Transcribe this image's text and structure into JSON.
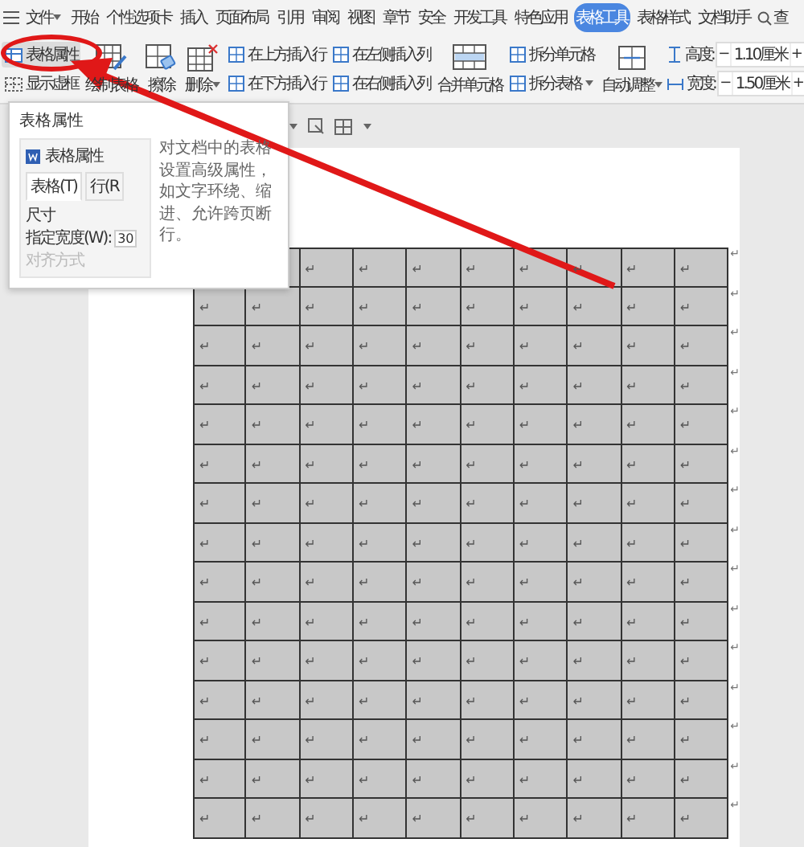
{
  "menubar": {
    "items": [
      {
        "label": "文件",
        "selected": false
      },
      {
        "label": "开始",
        "selected": false
      },
      {
        "label": "个性选项卡",
        "selected": false
      },
      {
        "label": "插入",
        "selected": false
      },
      {
        "label": "页面布局",
        "selected": false
      },
      {
        "label": "引用",
        "selected": false
      },
      {
        "label": "审阅",
        "selected": false
      },
      {
        "label": "视图",
        "selected": false
      },
      {
        "label": "章节",
        "selected": false
      },
      {
        "label": "安全",
        "selected": false
      },
      {
        "label": "开发工具",
        "selected": false
      },
      {
        "label": "特色应用",
        "selected": false
      },
      {
        "label": "表格工具",
        "selected": true
      },
      {
        "label": "表格样式",
        "selected": false
      },
      {
        "label": "文档助手",
        "selected": false
      }
    ],
    "search": "查"
  },
  "ribbon": {
    "groups": [
      {
        "kind": "stack",
        "items": [
          {
            "label": "表格属性",
            "hovered": true,
            "dropdown": false
          },
          {
            "label": "显示虚框",
            "hovered": false,
            "dropdown": false
          }
        ]
      },
      {
        "kind": "large",
        "label": "绘制表格",
        "hovered": false,
        "dropdown": false
      },
      {
        "kind": "large",
        "label": "擦除",
        "hovered": false,
        "dropdown": false
      },
      {
        "kind": "large",
        "label": "删除",
        "hovered": false,
        "dropdown": true
      },
      {
        "kind": "stack",
        "items": [
          {
            "label": "在上方插入行",
            "hovered": false,
            "dropdown": false
          },
          {
            "label": "在下方插入行",
            "hovered": false,
            "dropdown": false
          }
        ]
      },
      {
        "kind": "stack",
        "items": [
          {
            "label": "在左侧插入列",
            "hovered": false,
            "dropdown": false
          },
          {
            "label": "在右侧插入列",
            "hovered": false,
            "dropdown": false
          }
        ]
      },
      {
        "kind": "large",
        "label": "合并单元格",
        "hovered": false,
        "dropdown": false
      },
      {
        "kind": "stack",
        "items": [
          {
            "label": "拆分单元格",
            "hovered": false,
            "dropdown": false
          },
          {
            "label": "拆分表格",
            "hovered": false,
            "dropdown": true
          }
        ]
      },
      {
        "kind": "large",
        "label": "自动调整",
        "hovered": false,
        "dropdown": true
      },
      {
        "kind": "size",
        "rows": [
          {
            "label": "高度:",
            "value": "1.10厘米",
            "minus": "−",
            "plus": "+"
          },
          {
            "label": "宽度:",
            "value": "1.50厘米",
            "minus": "−",
            "plus": "+"
          }
        ]
      }
    ]
  },
  "tooltip": {
    "title": "表格属性",
    "preview": {
      "title": "表格属性",
      "tabs": [
        {
          "label": "表格(T)",
          "selected": true
        },
        {
          "label": "行(R",
          "selected": false
        }
      ],
      "section": "尺寸",
      "width_label": "指定宽度(W):",
      "width_value": "30",
      "section_2": "对齐方式"
    },
    "description": "对文档中的表格设置高级属性，如文字环绕、缩进、允许跨页断行。"
  },
  "table": {
    "rows": [
      {
        "cells": [
          null,
          null,
          "↵",
          "↵",
          "↵",
          "↵",
          "↵",
          "↵",
          "↵",
          "↵"
        ],
        "end": "↵"
      },
      {
        "cells": [
          "↵",
          "↵",
          "↵",
          "↵",
          "↵",
          "↵",
          "↵",
          "↵",
          "↵",
          "↵"
        ],
        "end": "↵"
      },
      {
        "cells": [
          "↵",
          "↵",
          "↵",
          "↵",
          "↵",
          "↵",
          "↵",
          "↵",
          "↵",
          "↵"
        ],
        "end": "↵"
      },
      {
        "cells": [
          "↵",
          "↵",
          "↵",
          "↵",
          "↵",
          "↵",
          "↵",
          "↵",
          "↵",
          "↵"
        ],
        "end": "↵"
      },
      {
        "cells": [
          "↵",
          "↵",
          "↵",
          "↵",
          "↵",
          "↵",
          "↵",
          "↵",
          "↵",
          "↵"
        ],
        "end": "↵"
      },
      {
        "cells": [
          "↵",
          "↵",
          "↵",
          "↵",
          "↵",
          "↵",
          "↵",
          "↵",
          "↵",
          "↵"
        ],
        "end": "↵"
      },
      {
        "cells": [
          "↵",
          "↵",
          "↵",
          "↵",
          "↵",
          "↵",
          "↵",
          "↵",
          "↵",
          "↵"
        ],
        "end": "↵"
      },
      {
        "cells": [
          "↵",
          "↵",
          "↵",
          "↵",
          "↵",
          "↵",
          "↵",
          "↵",
          "↵",
          "↵"
        ],
        "end": "↵"
      },
      {
        "cells": [
          "↵",
          "↵",
          "↵",
          "↵",
          "↵",
          "↵",
          "↵",
          "↵",
          "↵",
          "↵"
        ],
        "end": "↵"
      },
      {
        "cells": [
          "↵",
          "↵",
          "↵",
          "↵",
          "↵",
          "↵",
          "↵",
          "↵",
          "↵",
          "↵"
        ],
        "end": "↵"
      },
      {
        "cells": [
          "↵",
          "↵",
          "↵",
          "↵",
          "↵",
          "↵",
          "↵",
          "↵",
          "↵",
          "↵"
        ],
        "end": "↵"
      },
      {
        "cells": [
          "↵",
          "↵",
          "↵",
          "↵",
          "↵",
          "↵",
          "↵",
          "↵",
          "↵",
          "↵"
        ],
        "end": "↵"
      },
      {
        "cells": [
          "↵",
          "↵",
          "↵",
          "↵",
          "↵",
          "↵",
          "↵",
          "↵",
          "↵",
          "↵"
        ],
        "end": "↵"
      },
      {
        "cells": [
          "↵",
          "↵",
          "↵",
          "↵",
          "↵",
          "↵",
          "↵",
          "↵",
          "↵",
          "↵"
        ],
        "end": "↵"
      },
      {
        "cells": [
          "↵",
          "↵",
          "↵",
          "↵",
          "↵",
          "↵",
          "↵",
          "↵",
          "↵",
          "↵"
        ],
        "end": "↵"
      }
    ]
  }
}
